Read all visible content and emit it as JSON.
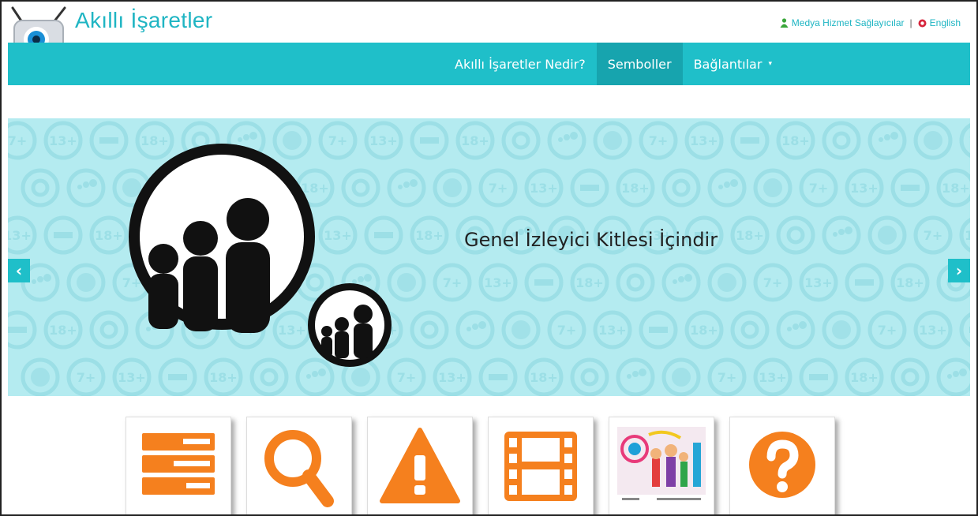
{
  "header": {
    "brand": "Akıllı İşaretler",
    "top_links": {
      "providers": "Medya Hizmet Sağlayıcılar",
      "separator": "|",
      "english": "English"
    }
  },
  "nav": {
    "items": [
      {
        "label": "Akıllı İşaretler Nedir?",
        "active": false
      },
      {
        "label": "Semboller",
        "active": true
      },
      {
        "label": "Bağlantılar",
        "active": false,
        "dropdown": true
      }
    ],
    "dropdown_caret": "▾"
  },
  "slider": {
    "caption": "Genel İzleyici Kitlesi İçindir",
    "prev_label": "‹",
    "next_label": "›",
    "pattern_labels": [
      "7+",
      "13+",
      "18+"
    ]
  },
  "tiles": [
    {
      "icon": "list-icon"
    },
    {
      "icon": "search-icon"
    },
    {
      "icon": "warning-icon"
    },
    {
      "icon": "film-icon"
    },
    {
      "icon": "drawing-thumbnail"
    },
    {
      "icon": "question-icon"
    }
  ],
  "colors": {
    "accent": "#1fbfc9",
    "accent_dark": "#17a4ae",
    "slider_bg": "#b4ebf0",
    "tile_orange": "#f5801e"
  }
}
